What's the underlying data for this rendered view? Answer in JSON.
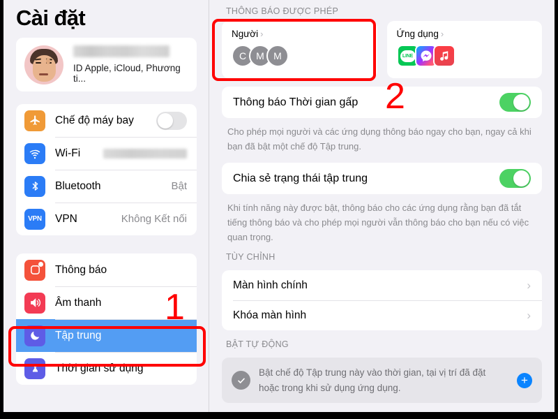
{
  "sidebar": {
    "title": "Cài đặt",
    "account": {
      "name_redacted": true,
      "subtitle": "ID Apple, iCloud, Phương ti..."
    },
    "group1": [
      {
        "label": "Chế độ máy bay",
        "icon": "airplane-icon",
        "control": "toggle-off",
        "value": ""
      },
      {
        "label": "Wi-Fi",
        "icon": "wifi-icon",
        "control": "redacted",
        "value": ""
      },
      {
        "label": "Bluetooth",
        "icon": "bluetooth-icon",
        "control": "text",
        "value": "Bật"
      },
      {
        "label": "VPN",
        "icon": "vpn-icon",
        "control": "text",
        "value": "Không Kết nối"
      }
    ],
    "group2": [
      {
        "label": "Thông báo",
        "icon": "notifications-icon",
        "selected": false
      },
      {
        "label": "Âm thanh",
        "icon": "sound-icon",
        "selected": false
      },
      {
        "label": "Tập trung",
        "icon": "focus-moon-icon",
        "selected": true
      },
      {
        "label": "Thời gian sử dụng",
        "icon": "screentime-hourglass-icon",
        "selected": false
      }
    ]
  },
  "detail": {
    "allowed_header": "THÔNG BÁO ĐƯỢC PHÉP",
    "people_card": {
      "title": "Người",
      "avatars": [
        "C",
        "M",
        "M"
      ]
    },
    "apps_card": {
      "title": "Ứng dụng",
      "apps": [
        "LINE",
        "Messenger",
        "Music"
      ]
    },
    "time_sensitive": {
      "label": "Thông báo Thời gian gấp",
      "toggle": "on",
      "note": "Cho phép mọi người và các ứng dụng thông báo ngay cho bạn, ngay cả khi bạn đã bật một chế độ Tập trung."
    },
    "share_focus": {
      "label": "Chia sẻ trạng thái tập trung",
      "toggle": "on",
      "note": "Khi tính năng này được bật, thông báo cho các ứng dụng rằng bạn đã tắt tiếng thông báo và cho phép mọi người vẫn thông báo cho bạn nếu có việc quan trọng."
    },
    "customize_header": "TÙY CHỈNH",
    "customize_rows": [
      "Màn hình chính",
      "Khóa màn hình"
    ],
    "auto_header": "BẬT TỰ ĐỘNG",
    "auto_note": "Bật chế độ Tập trung này vào thời gian, tại vị trí đã đặt hoặc trong khi sử dụng ứng dụng."
  },
  "annotations": {
    "step1": "1",
    "step2": "2",
    "color": "#FF0000"
  },
  "icon_text": {
    "line": "LINE",
    "airplane": "✈",
    "wifi": "",
    "bluetooth": "",
    "vpn": "VPN",
    "note": "♪",
    "moon": "",
    "hourglass": "⧗",
    "check": "✓",
    "plus": "+",
    "chevron": "›"
  }
}
